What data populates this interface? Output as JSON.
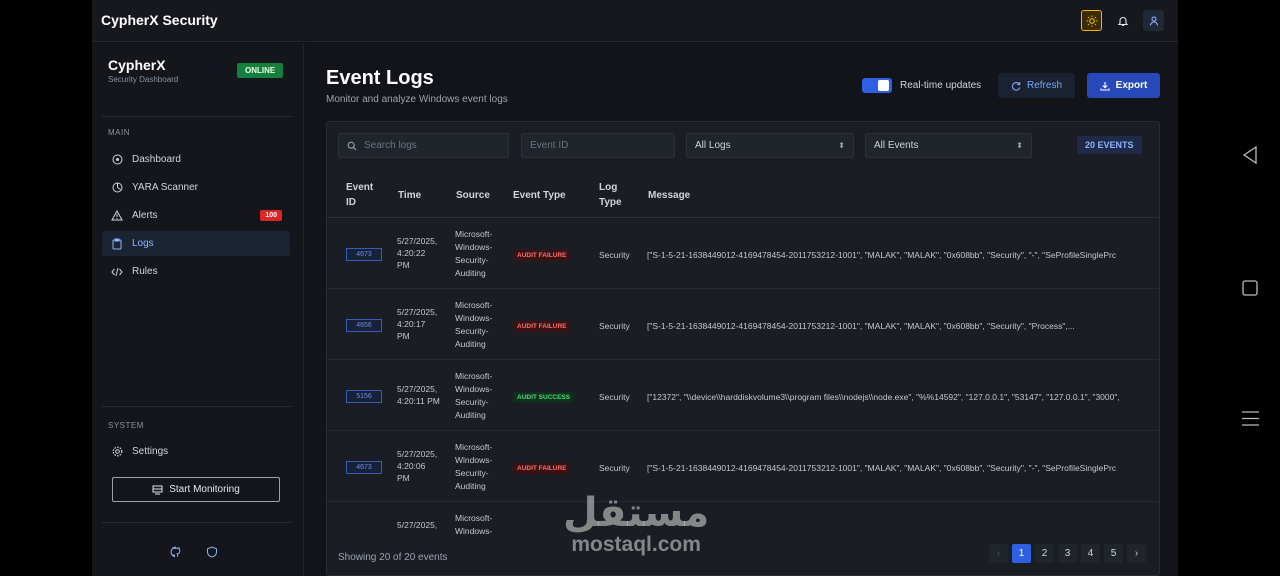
{
  "app": {
    "title": "CypherX Security"
  },
  "sidebar": {
    "brand_name": "CypherX",
    "brand_sub": "Security Dashboard",
    "status": "ONLINE",
    "main_label": "MAIN",
    "items": [
      {
        "label": "Dashboard",
        "icon": "dashboard-icon"
      },
      {
        "label": "YARA Scanner",
        "icon": "scanner-icon"
      },
      {
        "label": "Alerts",
        "icon": "warning-icon",
        "badge": "100"
      },
      {
        "label": "Logs",
        "icon": "clipboard-icon"
      },
      {
        "label": "Rules",
        "icon": "code-icon"
      }
    ],
    "system_label": "SYSTEM",
    "settings_label": "Settings",
    "start_monitoring": "Start Monitoring"
  },
  "main": {
    "title": "Event Logs",
    "subtitle": "Monitor and analyze Windows event logs",
    "realtime_label": "Real-time updates",
    "realtime_on": true,
    "refresh_label": "Refresh",
    "export_label": "Export"
  },
  "filters": {
    "search_placeholder": "Search logs",
    "event_id_placeholder": "Event ID",
    "log_select": "All Logs",
    "event_select": "All Events",
    "count": "20 EVENTS"
  },
  "table": {
    "headers": {
      "event_id_1": "Event",
      "event_id_2": "ID",
      "time": "Time",
      "source": "Source",
      "event_type": "Event Type",
      "log_type_1": "Log",
      "log_type_2": "Type",
      "message": "Message"
    },
    "rows": [
      {
        "event_id": "4673",
        "time_1": "5/27/2025,",
        "time_2": "4:20:22",
        "time_3": "PM",
        "src_1": "Microsoft-",
        "src_2": "Windows-",
        "src_3": "Security-",
        "src_4": "Auditing",
        "event_type": "AUDIT FAILURE",
        "log_type": "Security",
        "message": "[\"S-1-5-21-1638449012-4169478454-2011753212-1001\", \"MALAK\", \"MALAK\", \"0x608bb\", \"Security\", \"-\", \"SeProfileSinglePrc"
      },
      {
        "event_id": "4656",
        "time_1": "5/27/2025,",
        "time_2": "4:20:17",
        "time_3": "PM",
        "src_1": "Microsoft-",
        "src_2": "Windows-",
        "src_3": "Security-",
        "src_4": "Auditing",
        "event_type": "AUDIT FAILURE",
        "log_type": "Security",
        "message": "[\"S-1-5-21-1638449012-4169478454-2011753212-1001\", \"MALAK\", \"MALAK\", \"0x608bb\", \"Security\", \"Process\",..."
      },
      {
        "event_id": "5156",
        "time_1": "5/27/2025,",
        "time_2": "4:20:11 PM",
        "time_3": "",
        "src_1": "Microsoft-",
        "src_2": "Windows-",
        "src_3": "Security-",
        "src_4": "Auditing",
        "event_type": "AUDIT SUCCESS",
        "log_type": "Security",
        "message": "[\"12372\", \"\\\\device\\\\harddiskvolume3\\\\program files\\\\nodejs\\\\node.exe\", \"%%14592\", \"127.0.0.1\", \"53147\", \"127.0.0.1\", \"3000\","
      },
      {
        "event_id": "4673",
        "time_1": "5/27/2025,",
        "time_2": "4:20:06",
        "time_3": "PM",
        "src_1": "Microsoft-",
        "src_2": "Windows-",
        "src_3": "Security-",
        "src_4": "Auditing",
        "event_type": "AUDIT FAILURE",
        "log_type": "Security",
        "message": "[\"S-1-5-21-1638449012-4169478454-2011753212-1001\", \"MALAK\", \"MALAK\", \"0x608bb\", \"Security\", \"-\", \"SeProfileSinglePrc"
      },
      {
        "event_id": "",
        "time_1": "5/27/2025,",
        "time_2": "",
        "time_3": "",
        "src_1": "Microsoft-",
        "src_2": "Windows-",
        "src_3": "",
        "src_4": "",
        "event_type": "",
        "log_type": "",
        "message": ""
      }
    ]
  },
  "pagination": {
    "showing": "Showing 20 of 20 events",
    "pages": [
      "1",
      "2",
      "3",
      "4",
      "5"
    ],
    "prev": "‹",
    "next": "›"
  },
  "watermark": {
    "arabic": "مستقل",
    "latin": "mostaql.com"
  }
}
